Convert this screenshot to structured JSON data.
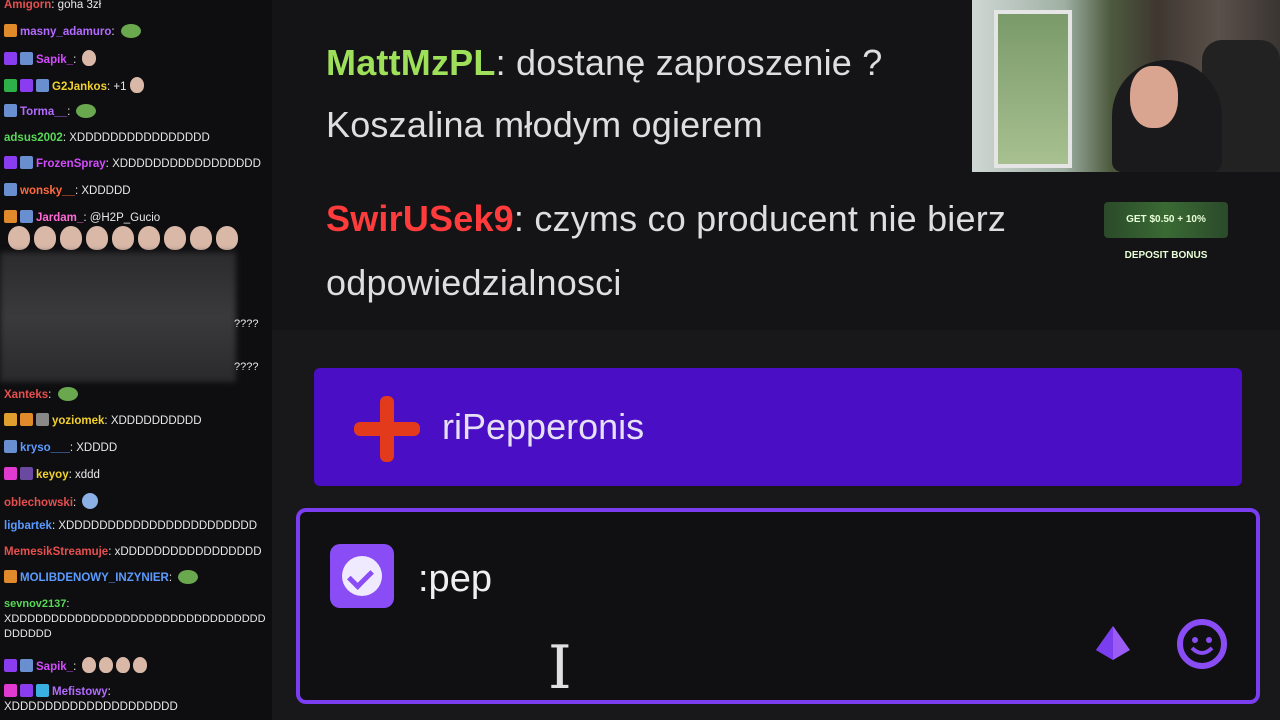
{
  "left_chat": {
    "messages": [
      {
        "user": "Amigorn",
        "user_color": "#e64f4f",
        "text": "goha 3zł"
      },
      {
        "user": "masny_adamuro",
        "user_color": "#b36aff",
        "text": ""
      },
      {
        "user": "Sapik_",
        "user_color": "#d44bff",
        "text": ""
      },
      {
        "user": "G2Jankos",
        "user_color": "#f2d12f",
        "text": "+1"
      },
      {
        "user": "Torma__",
        "user_color": "#b36aff",
        "text": ""
      },
      {
        "user": "adsus2002",
        "user_color": "#57d957",
        "text": "XDDDDDDDDDDDDDDDD"
      },
      {
        "user": "FrozenSpray",
        "user_color": "#d44bff",
        "text": "XDDDDDDDDDDDDDDDDD"
      },
      {
        "user": "wonsky__",
        "user_color": "#ff6a3d",
        "text": "XDDDDD"
      },
      {
        "user": "Jardam_",
        "user_color": "#ff6ad5",
        "text": "@H2P_Gucio"
      },
      {
        "user": "",
        "user_color": "",
        "text": "????"
      },
      {
        "user": "",
        "user_color": "",
        "text": "????"
      },
      {
        "user": "Xanteks",
        "user_color": "#e64f4f",
        "text": ""
      },
      {
        "user": "yoziomek",
        "user_color": "#f2d12f",
        "text": "XDDDDDDDDDD"
      },
      {
        "user": "kryso___",
        "user_color": "#5b9bff",
        "text": "XDDDD"
      },
      {
        "user": "keyoy",
        "user_color": "#f2d12f",
        "text": "xddd"
      },
      {
        "user": "oblechowski",
        "user_color": "#e64f4f",
        "text": ""
      },
      {
        "user": "ligbartek",
        "user_color": "#5b9bff",
        "text": "XDDDDDDDDDDDDDDDDDDDDDDD"
      },
      {
        "user": "MemesikStreamuje",
        "user_color": "#e64f4f",
        "text": "xDDDDDDDDDDDDDDDDD"
      },
      {
        "user": "MOLIBDENOWY_INZYNIER",
        "user_color": "#5b9bff",
        "text": ""
      },
      {
        "user": "sevnov2137",
        "user_color": "#57d957",
        "text": "XDDDDDDDDDDDDDDDDDDDDDDDDDDDDDDDDDDDDDD"
      },
      {
        "user": "Sapik_",
        "user_color": "#d44bff",
        "text": ""
      },
      {
        "user": "Mefistowy",
        "user_color": "#b36aff",
        "text": "XDDDDDDDDDDDDDDDDDDDD"
      }
    ]
  },
  "main_chat": {
    "line1": {
      "user": "MattMzPL",
      "user_color": "#9ee05a",
      "text": "dostanę zaproszenie ?"
    },
    "line2": {
      "text": "Koszalina młodym ogierem"
    },
    "line3": {
      "user": "SwirUSek9",
      "user_color": "#ff3b3b",
      "text": "czyms co producent nie bierz"
    },
    "line4": {
      "text": "odpowiedzialnosci"
    },
    "ad_text": "GET $0.50 + 10% DEPOSIT BONUS",
    "reply_banner": {
      "text": "riPepperonis"
    },
    "input": {
      "value": ":pep"
    }
  },
  "icons": {
    "emote_picker": "checkmark-badge-icon",
    "cursor": "text-cursor-icon",
    "bits": "bits-icon",
    "emoji": "emoji-smiley-icon"
  },
  "colors": {
    "accent": "#7a3df0",
    "banner": "#4a0fc4"
  }
}
